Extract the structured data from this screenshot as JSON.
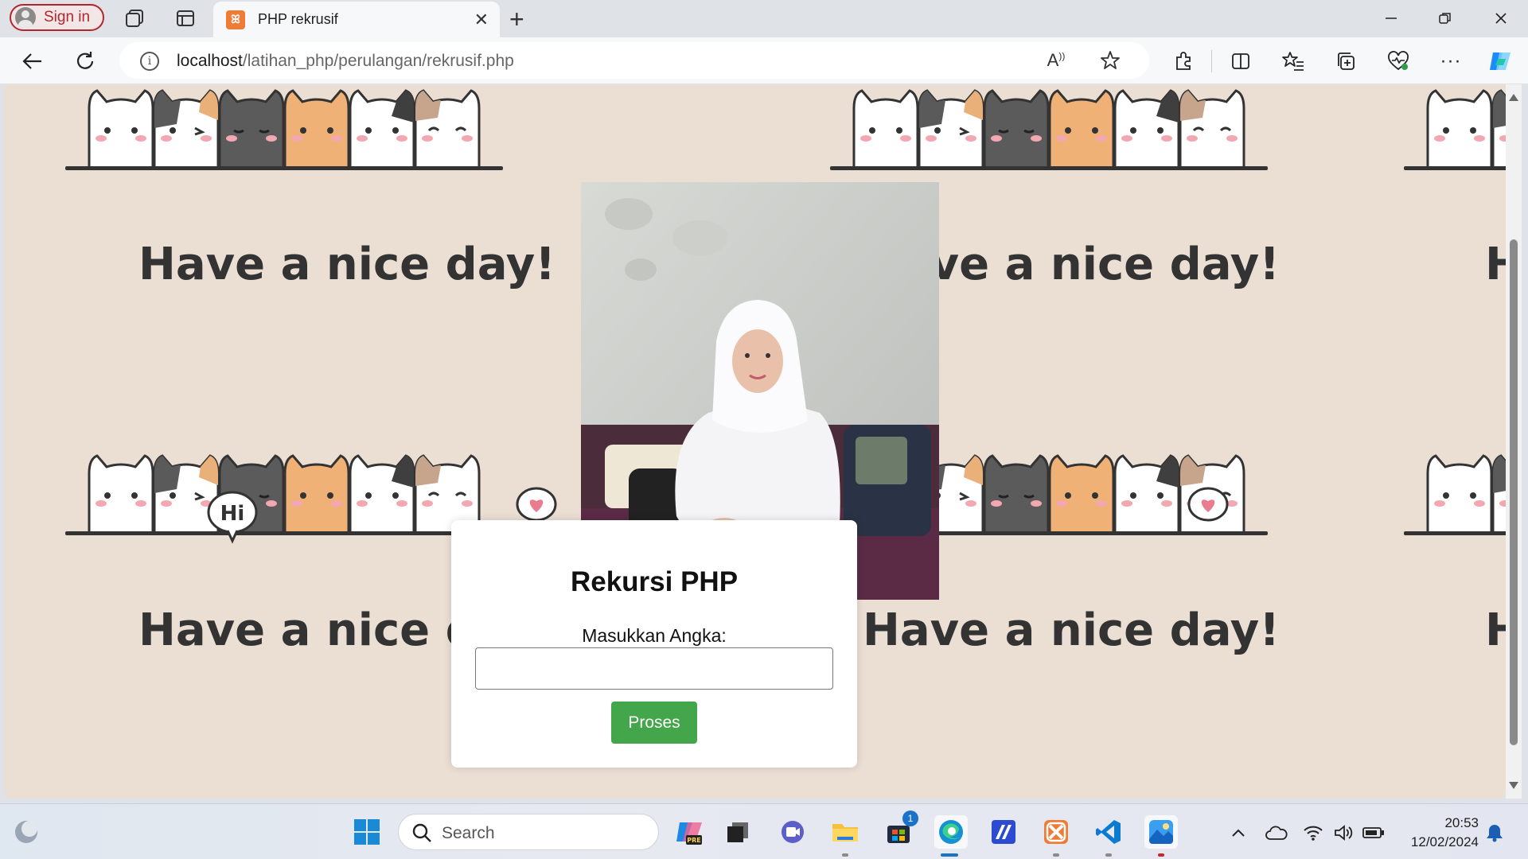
{
  "browser": {
    "signin_label": "Sign in",
    "tab_title": "PHP rekrusif",
    "url_host": "localhost",
    "url_path": "/latihan_php/perulangan/rekrusif.php",
    "accent": "#b3262e"
  },
  "wallpaper": {
    "greeting": "Have a nice day!",
    "bubble_hi": "Hi",
    "background": "#ebdfd4"
  },
  "page": {
    "heading": "Rekursi PHP",
    "input_label": "Masukkan Angka:",
    "input_value": "",
    "submit_label": "Proses",
    "submit_color": "#44a64a"
  },
  "taskbar": {
    "search_placeholder": "Search",
    "store_badge": "1",
    "time": "20:53",
    "date": "12/02/2024"
  }
}
